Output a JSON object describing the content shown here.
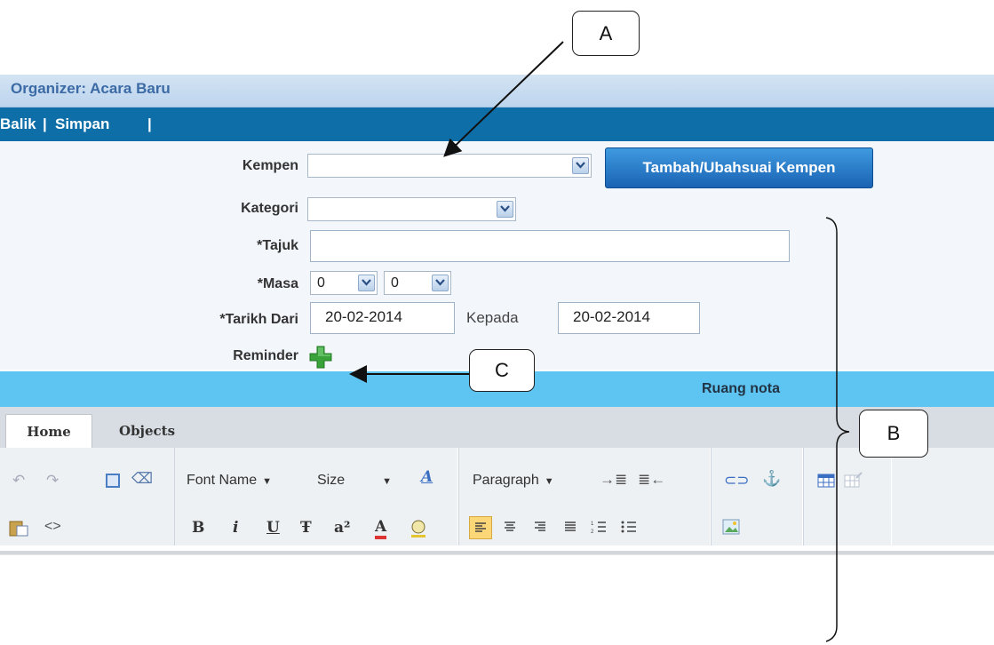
{
  "window": {
    "title": "Organizer: Acara Baru"
  },
  "nav": {
    "back": "Balik",
    "save": "Simpan",
    "separator": "|"
  },
  "form": {
    "kempen_label": "Kempen",
    "kempen_value": "",
    "kempen_button": "Tambah/Ubahsuai Kempen",
    "kategori_label": "Kategori",
    "kategori_value": "",
    "tajuk_label": "*Tajuk",
    "tajuk_value": "",
    "masa_label": "*Masa",
    "masa_hour": "0",
    "masa_minute": "0",
    "tarikh_dari_label": "*Tarikh Dari",
    "tarikh_dari_value": "20-02-2014",
    "kepada_label": "Kepada",
    "kepada_value": "20-02-2014",
    "reminder_label": "Reminder"
  },
  "notes": {
    "title": "Ruang nota"
  },
  "editor": {
    "tabs": [
      "Home",
      "Objects"
    ],
    "font_name": "Font Name",
    "size": "Size",
    "paragraph": "Paragraph",
    "format_buttons": [
      "B",
      "i",
      "U",
      "Ŧ",
      "a²",
      "A"
    ]
  },
  "annotations": {
    "a": "A",
    "b": "B",
    "c": "C"
  },
  "colors": {
    "nav_bar": "#0e6ea8",
    "notes_bar": "#5ec4f2",
    "button": "#1a63b3",
    "plus_icon": "#3aa23a"
  }
}
